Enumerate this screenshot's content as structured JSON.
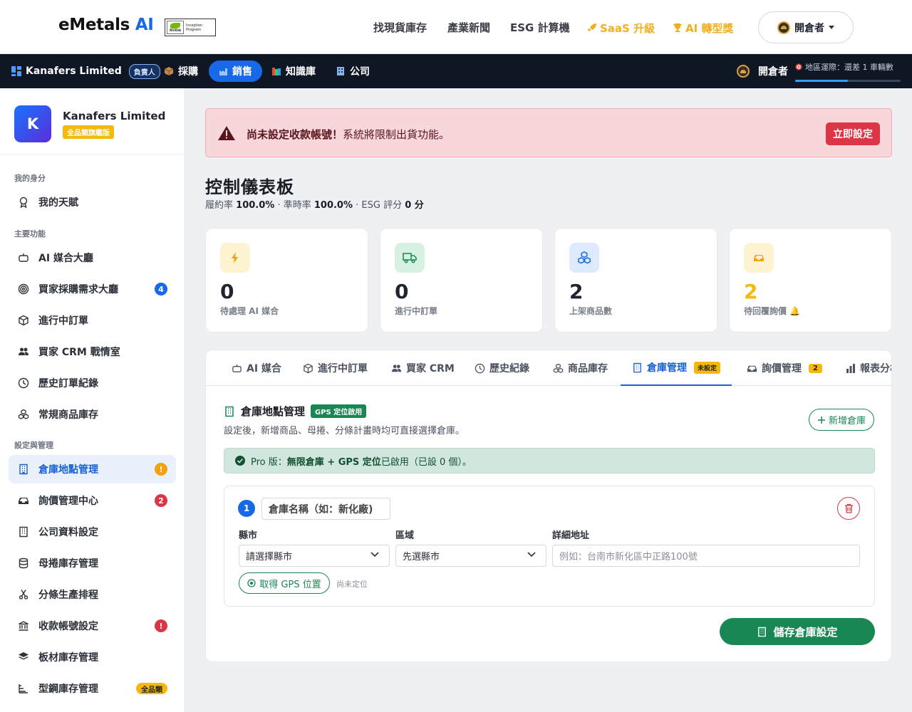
{
  "topbar": {
    "brand_main": "eMetals",
    "brand_ai": "AI",
    "nvidia_badge_line1": "Inception",
    "nvidia_badge_line2": "Program",
    "nvidia_logo_text": "NVIDIA",
    "nav": [
      "找現貨庫存",
      "產業新聞",
      "ESG 計算機"
    ],
    "saas": "SaaS 升級",
    "award": "AI 轉型獎",
    "user": "開倉者"
  },
  "navbar": {
    "company": "Kanafers Limited",
    "role": "負責人",
    "items": [
      "採購",
      "銷售",
      "知識庫",
      "公司"
    ],
    "user": "開倉者",
    "region_text": "地區運際：還差 1 車輛數",
    "progress": 0.5
  },
  "sidebar": {
    "company_initial": "K",
    "company_name": "Kanafers Limited",
    "company_tag": "全品類旗艦版",
    "sections": [
      "我的身分",
      "主要功能",
      "設定與管理"
    ],
    "items": [
      {
        "label": "我的天賦"
      },
      {
        "label": "AI 媒合大廳"
      },
      {
        "label": "買家採購需求大廳",
        "badge": "4"
      },
      {
        "label": "進行中訂單"
      },
      {
        "label": "買家 CRM 戰情室"
      },
      {
        "label": "歷史訂單紀錄"
      },
      {
        "label": "常規商品庫存"
      },
      {
        "label": "倉庫地點管理",
        "badge": "!"
      },
      {
        "label": "詢價管理中心",
        "badge": "2"
      },
      {
        "label": "公司資料設定"
      },
      {
        "label": "母捲庫存管理"
      },
      {
        "label": "分條生產排程"
      },
      {
        "label": "收款帳號設定",
        "badge": "!"
      },
      {
        "label": "板材庫存管理"
      },
      {
        "label": "型鋼庫存管理",
        "badge": "全品類"
      }
    ]
  },
  "alert": {
    "bold": "尚未設定收款帳號！",
    "text": "系統將限制出貨功能。",
    "button": "立即設定"
  },
  "page": {
    "title": "控制儀表板",
    "s1_label": "履約率",
    "s1_value": "100.0%",
    "s2_label": "· 準時率",
    "s2_value": "100.0%",
    "s3_label": "· ESG 評分",
    "s3_value": "0 分"
  },
  "stats": [
    {
      "value": "0",
      "label": "待處理 AI 媒合",
      "color": "#f2b01e"
    },
    {
      "value": "0",
      "label": "進行中訂單",
      "color": "#198754"
    },
    {
      "value": "2",
      "label": "上架商品數",
      "color": "#1769e8"
    },
    {
      "value": "2",
      "label": "待回覆詢價 🔔",
      "color": "#f5b90c"
    }
  ],
  "tabs": [
    {
      "label": "AI 媒合"
    },
    {
      "label": "進行中訂單"
    },
    {
      "label": "買家 CRM"
    },
    {
      "label": "歷史紀錄"
    },
    {
      "label": "商品庫存"
    },
    {
      "label": "倉庫管理",
      "badge": "未設定"
    },
    {
      "label": "詢價管理",
      "badge": "2"
    },
    {
      "label": "報表分析"
    }
  ],
  "warehouse": {
    "title": "倉庫地點管理",
    "gps_badge": "GPS 定位啟用",
    "subtitle": "設定後，新增商品、母捲、分條計畫時均可直接選擇倉庫。",
    "add_button": "新增倉庫",
    "pro_prefix": "Pro 版：",
    "pro_bold": "無限倉庫 + GPS 定位",
    "pro_suffix": "已啟用（已設 0 個）。",
    "entry_number": "1",
    "name_placeholder": "倉庫名稱（如：新化廠)",
    "county_label": "縣市",
    "county_value": "請選擇縣市",
    "district_label": "區域",
    "district_value": "先選縣市",
    "address_label": "詳細地址",
    "address_placeholder": "例如：台南市新化區中正路100號",
    "gps_button": "取得 GPS 位置",
    "gps_status": "尚未定位",
    "save_button": "儲存倉庫設定"
  },
  "colors": {
    "primary": "#1769e8",
    "success": "#198754",
    "danger": "#dc3545",
    "warning": "#f5b90c",
    "navbar": "#0f1725"
  }
}
